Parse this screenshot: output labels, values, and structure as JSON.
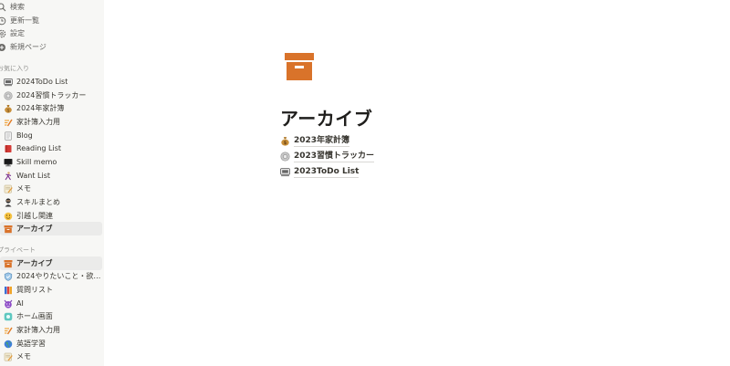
{
  "sidebar": {
    "top_items": [
      {
        "label": "検索",
        "icon": "search-icon"
      },
      {
        "label": "更新一覧",
        "icon": "clock-icon"
      },
      {
        "label": "設定",
        "icon": "gear-icon"
      },
      {
        "label": "新規ページ",
        "icon": "plus-circle-icon"
      }
    ],
    "favorites_header": "お気に入り",
    "favorites": [
      {
        "label": "2024ToDo List",
        "icon": "keyboard-icon"
      },
      {
        "label": "2024習慣トラッカー",
        "icon": "gear-badge-icon"
      },
      {
        "label": "2024年家計簿",
        "icon": "money-bag-icon"
      },
      {
        "label": "家計簿入力用",
        "icon": "pencil-icon"
      },
      {
        "label": "Blog",
        "icon": "notebook-icon"
      },
      {
        "label": "Reading List",
        "icon": "red-book-icon"
      },
      {
        "label": "Skill memo",
        "icon": "computer-icon"
      },
      {
        "label": "Want List",
        "icon": "person-icon"
      },
      {
        "label": "メモ",
        "icon": "memo-icon"
      },
      {
        "label": "スキルまとめ",
        "icon": "ninja-icon"
      },
      {
        "label": "引越し関連",
        "icon": "face-icon"
      },
      {
        "label": "アーカイブ",
        "icon": "archive-box-icon",
        "selected": true
      }
    ],
    "private_header": "プライベート",
    "private": [
      {
        "label": "アーカイブ",
        "icon": "archive-box-icon",
        "selected": true
      },
      {
        "label": "2024やりたいこと・欲…",
        "icon": "shield-icon"
      },
      {
        "label": "質問リスト",
        "icon": "books-icon"
      },
      {
        "label": "AI",
        "icon": "devil-icon"
      },
      {
        "label": "ホーム画面",
        "icon": "teal-app-icon"
      },
      {
        "label": "家計簿入力用",
        "icon": "pencil-icon"
      },
      {
        "label": "英語学習",
        "icon": "globe-icon"
      },
      {
        "label": "メモ",
        "icon": "memo-icon"
      }
    ]
  },
  "page": {
    "icon": "archive-box-icon",
    "title": "アーカイブ",
    "links": [
      {
        "label": "2023年家計簿",
        "icon": "money-bag-icon"
      },
      {
        "label": "2023習慣トラッカー",
        "icon": "gear-badge-icon"
      },
      {
        "label": "2023ToDo List",
        "icon": "keyboard-icon"
      }
    ]
  },
  "colors": {
    "sidebar_bg": "#f7f7f5",
    "archive_orange": "#d9732a",
    "text": "#37352f"
  }
}
